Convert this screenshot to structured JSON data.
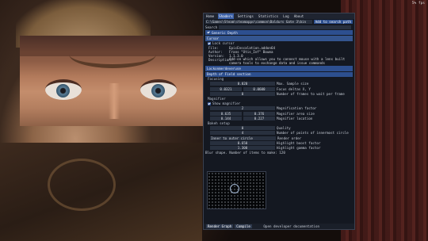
{
  "corner_tag": "5% fps",
  "menu": [
    "Home",
    "Shaders",
    "Settings",
    "Statistics",
    "Log",
    "About"
  ],
  "menu_active": 1,
  "path_label": "C:\\",
  "path_value": "C:\\Games\\Steam\\steamapps\\common\\Baldurs Gate 3\\bin",
  "add_button": "Add to search path",
  "search_label": "Search",
  "generic_depth": "Generic Depth",
  "cursor_header": "Cursor",
  "cursor_lock": "Lock cursor",
  "addon": {
    "file": "EpicEnscalation.addon64",
    "author": "Frans \"Otis_Inf\" Bouma",
    "version": "1.1.3.0",
    "description": "Add-on which allows you to connect mouse with a lens built camera tools to exchange data and issue commands"
  },
  "headers": [
    "Lockonmerdeveruse",
    "Depth of Field section"
  ],
  "focusing_header": "Focusing",
  "focusing": [
    {
      "vals": [
        "0.020"
      ],
      "label": "Max. Sample size"
    },
    {
      "vals": [
        "0.0321",
        "0.0600"
      ],
      "label": "Focus deltas X, Y"
    },
    {
      "vals": [
        "0"
      ],
      "label": "Number of frames to wait per frame"
    }
  ],
  "magnifier_header": "Magnifier",
  "show_magnifier": "Show magnifier",
  "magnifier": [
    {
      "vals": [
        "2"
      ],
      "label": "Magnification factor"
    },
    {
      "vals": [
        "0.635",
        "0.376"
      ],
      "label": "Magnifier area size"
    },
    {
      "vals": [
        "0.144",
        "0.227"
      ],
      "label": "Magnifier location"
    }
  ],
  "bokeh_header": "Bokeh setup",
  "bokeh": [
    {
      "vals": [
        "0"
      ],
      "label": "Quality"
    },
    {
      "vals": [
        "4"
      ],
      "label": "Number of points of innermost circle"
    }
  ],
  "render_mode_value": "Inner to outer circle",
  "render_mode_label": "Render order",
  "bokeh2": [
    {
      "vals": [
        "0.650"
      ],
      "label": "Highlight boost factor"
    },
    {
      "vals": [
        "1.300"
      ],
      "label": "Highlight gamma factor"
    }
  ],
  "blur_shape": "Blur shape. Number of items to make: 120",
  "bottom_buttons": [
    "Render Graph",
    "Compile"
  ],
  "footer": "Open developer documentation"
}
